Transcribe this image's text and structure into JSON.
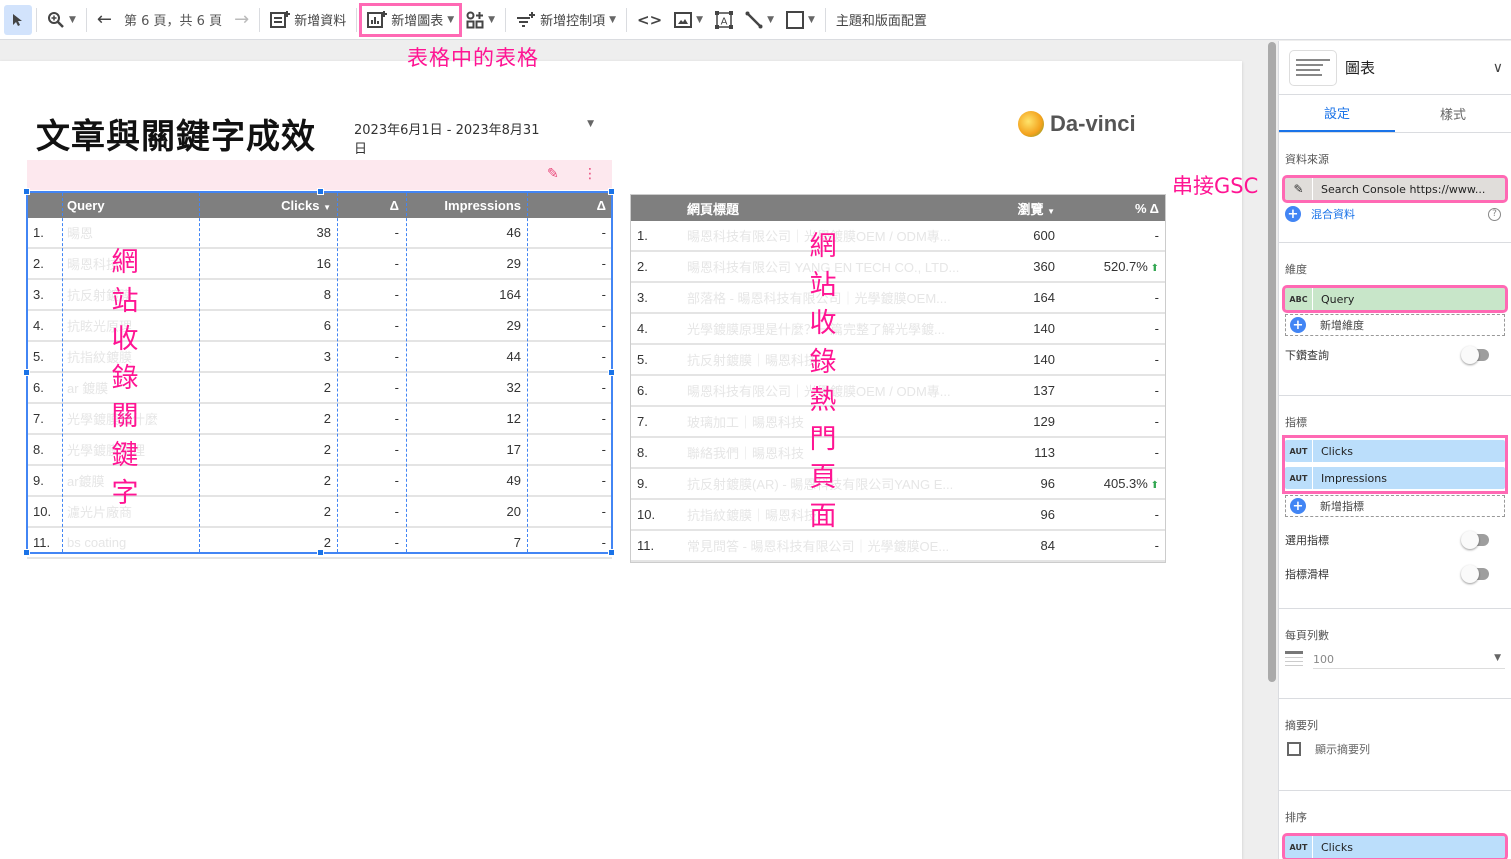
{
  "toolbar": {
    "page_indicator": "第 6 頁，共 6 頁",
    "add_data": "新增資料",
    "add_chart": "新增圖表",
    "add_control": "新增控制項",
    "theme_layout": "主題和版面配置"
  },
  "annotations": {
    "table_in_table": "表格中的表格",
    "connect_gsc": "串接GSC",
    "indexed_keywords": [
      "網",
      "站",
      "收",
      "錄",
      "關",
      "鍵",
      "字"
    ],
    "indexed_pages": [
      "網",
      "站",
      "收",
      "錄",
      "熱",
      "門",
      "頁",
      "面"
    ]
  },
  "report": {
    "title": "文章與關鍵字成效",
    "date_range": "2023年6月1日 - 2023年8月31日",
    "logo_text": "Da-vinci"
  },
  "keyword_table": {
    "columns": [
      "Query",
      "Clicks",
      "Δ",
      "Impressions",
      "Δ"
    ],
    "sort_column": "Clicks",
    "rows": [
      {
        "idx": "1.",
        "query": "暘恩",
        "clicks": "38",
        "clicks_delta": "-",
        "impressions": "46",
        "impressions_delta": "-"
      },
      {
        "idx": "2.",
        "query": "暘恩科技",
        "clicks": "16",
        "clicks_delta": "-",
        "impressions": "29",
        "impressions_delta": "-"
      },
      {
        "idx": "3.",
        "query": "抗反射鍍膜",
        "clicks": "8",
        "clicks_delta": "-",
        "impressions": "164",
        "impressions_delta": "-"
      },
      {
        "idx": "4.",
        "query": "抗眩光原理",
        "clicks": "6",
        "clicks_delta": "-",
        "impressions": "29",
        "impressions_delta": "-"
      },
      {
        "idx": "5.",
        "query": "抗指紋鍍膜",
        "clicks": "3",
        "clicks_delta": "-",
        "impressions": "44",
        "impressions_delta": "-"
      },
      {
        "idx": "6.",
        "query": "ar 鍍膜",
        "clicks": "2",
        "clicks_delta": "-",
        "impressions": "32",
        "impressions_delta": "-"
      },
      {
        "idx": "7.",
        "query": "光學鍍膜是什麼",
        "clicks": "2",
        "clicks_delta": "-",
        "impressions": "12",
        "impressions_delta": "-"
      },
      {
        "idx": "8.",
        "query": "光學鍍膜原理",
        "clicks": "2",
        "clicks_delta": "-",
        "impressions": "17",
        "impressions_delta": "-"
      },
      {
        "idx": "9.",
        "query": "ar鍍膜",
        "clicks": "2",
        "clicks_delta": "-",
        "impressions": "49",
        "impressions_delta": "-"
      },
      {
        "idx": "10.",
        "query": "濾光片廠商",
        "clicks": "2",
        "clicks_delta": "-",
        "impressions": "20",
        "impressions_delta": "-"
      },
      {
        "idx": "11.",
        "query": "bs coating",
        "clicks": "2",
        "clicks_delta": "-",
        "impressions": "7",
        "impressions_delta": "-"
      }
    ]
  },
  "pages_table": {
    "columns": [
      "網頁標題",
      "瀏覽",
      "% Δ"
    ],
    "sort_column": "瀏覽",
    "rows": [
      {
        "idx": "1.",
        "title": "暘恩科技有限公司｜光學鍍膜OEM / ODM專...",
        "views": "600",
        "delta": "-",
        "up": false
      },
      {
        "idx": "2.",
        "title": "暘恩科技有限公司 YANG EN TECH CO., LTD...",
        "views": "360",
        "delta": "520.7%",
        "up": true
      },
      {
        "idx": "3.",
        "title": "部落格 - 暘恩科技有限公司｜光學鍍膜OEM...",
        "views": "164",
        "delta": "-",
        "up": false
      },
      {
        "idx": "4.",
        "title": "光學鍍膜原理是什麼？一篇完整了解光學鍍...",
        "views": "140",
        "delta": "-",
        "up": false
      },
      {
        "idx": "5.",
        "title": "抗反射鍍膜｜暘恩科技",
        "views": "140",
        "delta": "-",
        "up": false
      },
      {
        "idx": "6.",
        "title": "暘恩科技有限公司｜光學鍍膜OEM / ODM專...",
        "views": "137",
        "delta": "-",
        "up": false
      },
      {
        "idx": "7.",
        "title": "玻璃加工｜暘恩科技",
        "views": "129",
        "delta": "-",
        "up": false
      },
      {
        "idx": "8.",
        "title": "聯絡我們｜暘恩科技",
        "views": "113",
        "delta": "-",
        "up": false
      },
      {
        "idx": "9.",
        "title": "抗反射鍍膜(AR) - 暘恩科技有限公司YANG E...",
        "views": "96",
        "delta": "405.3%",
        "up": true
      },
      {
        "idx": "10.",
        "title": "抗指紋鍍膜｜暘恩科技",
        "views": "96",
        "delta": "-",
        "up": false
      },
      {
        "idx": "11.",
        "title": "常見問答 - 暘恩科技有限公司｜光學鍍膜OE...",
        "views": "84",
        "delta": "-",
        "up": false
      }
    ]
  },
  "panel": {
    "title": "圖表",
    "tabs": [
      "設定",
      "樣式"
    ],
    "active_tab": "設定",
    "data_source_label": "資料來源",
    "data_source": "Search Console https://www...",
    "blend_data": "混合資料",
    "dimension_label": "維度",
    "dimension": {
      "type": "ABC",
      "name": "Query"
    },
    "add_dimension": "新增維度",
    "drill_down": "下鑽查詢",
    "metric_label": "指標",
    "metrics": [
      {
        "type": "AUT",
        "name": "Clicks"
      },
      {
        "type": "AUT",
        "name": "Impressions"
      }
    ],
    "add_metric": "新增指標",
    "optional_metrics": "選用指標",
    "metric_slider": "指標滑桿",
    "rows_per_page_label": "每頁列數",
    "rows_per_page": "100",
    "summary_label": "摘要列",
    "show_summary": "顯示摘要列",
    "sort_label": "排序",
    "sort": {
      "type": "AUT",
      "name": "Clicks"
    }
  },
  "colors": {
    "accent": "#1a73e8",
    "annotation": "#ff1493",
    "highlight": "#ff69b4",
    "table_header": "#7f7f7f",
    "positive": "#34a853"
  }
}
